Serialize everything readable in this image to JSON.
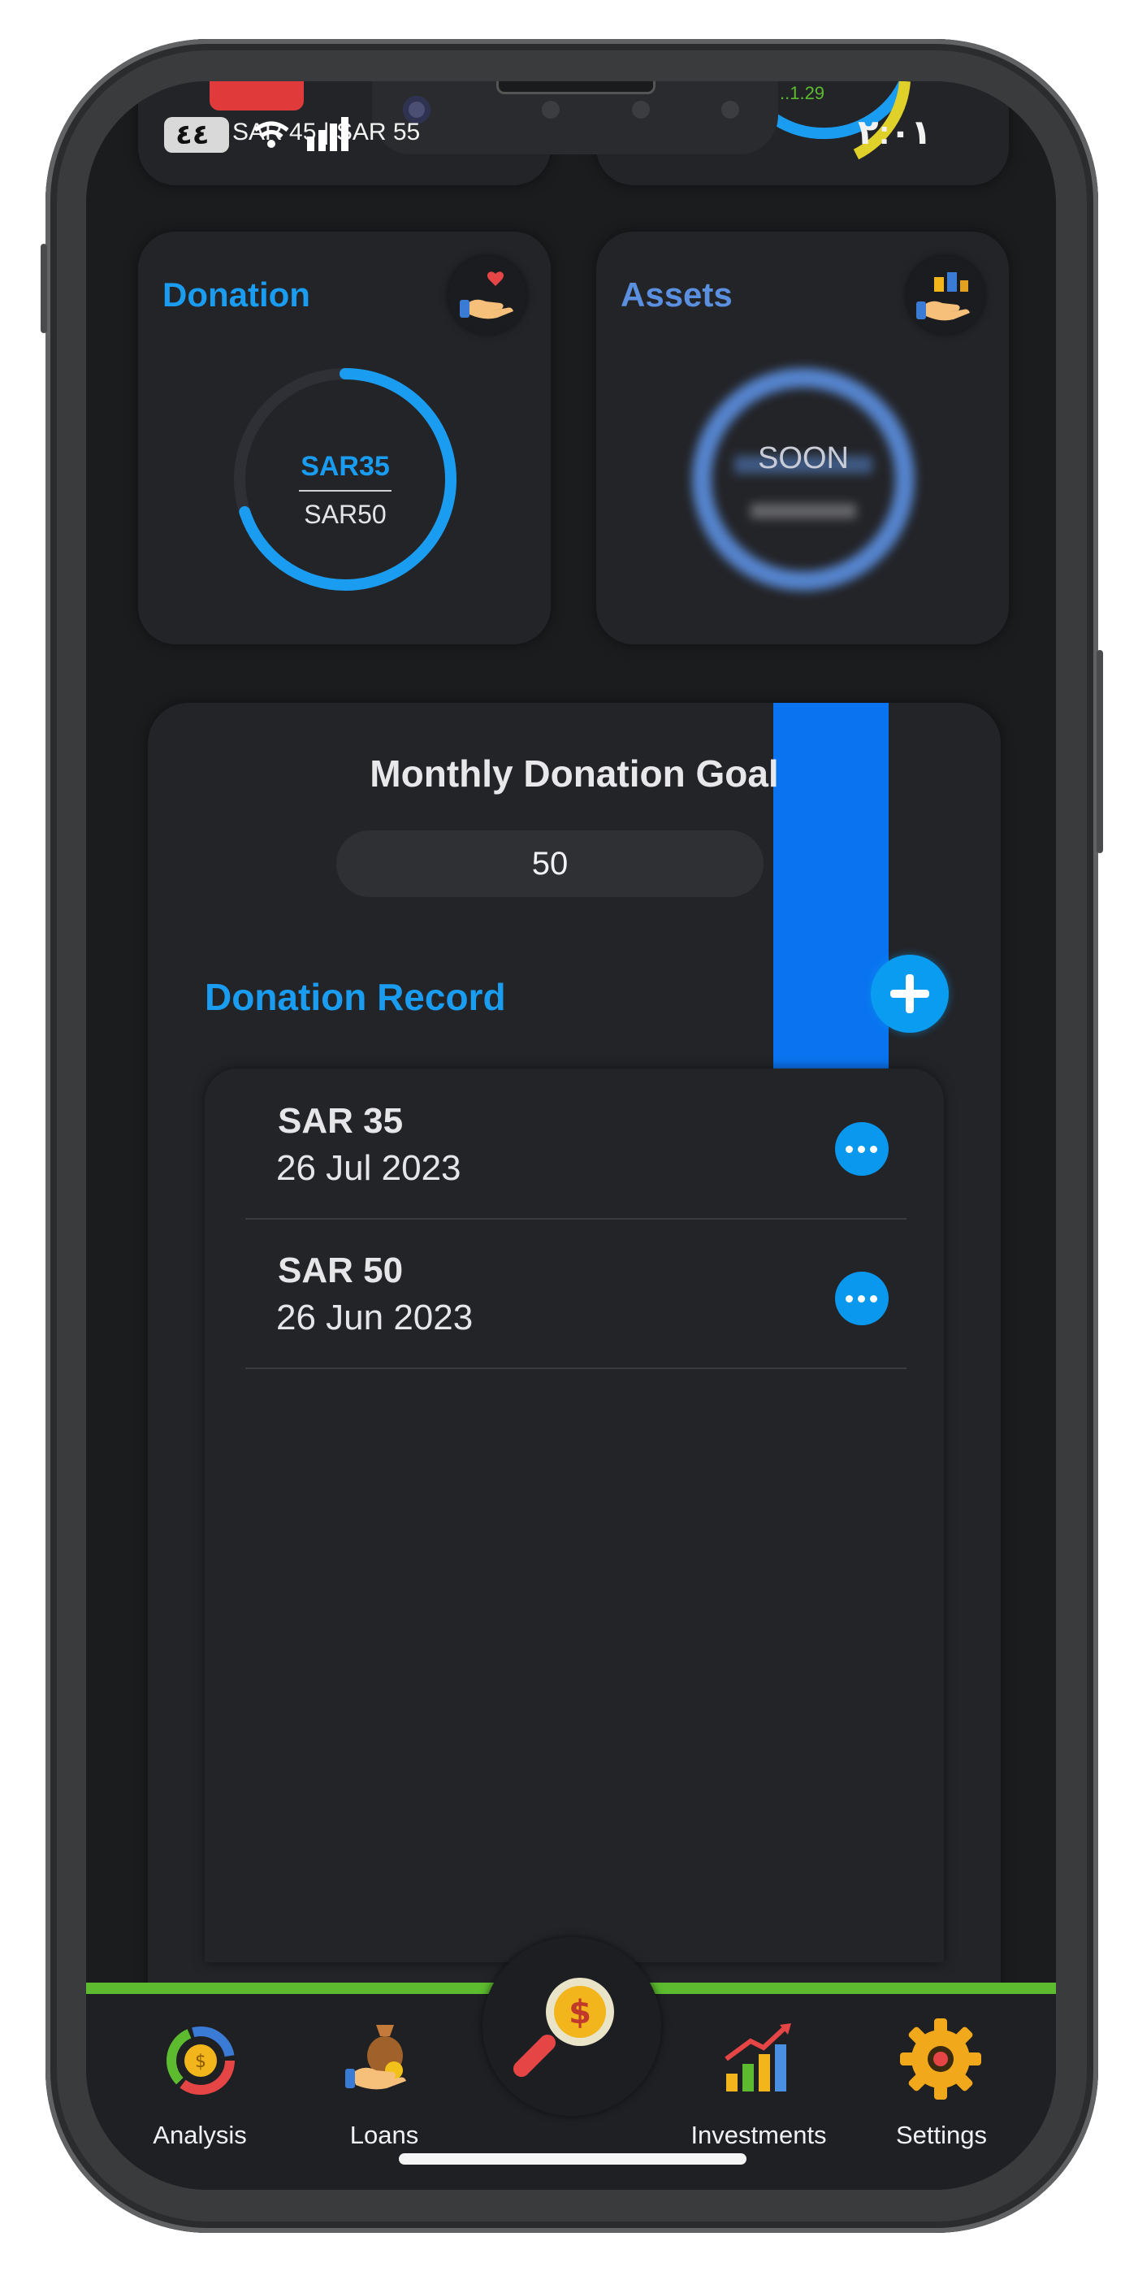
{
  "status_bar": {
    "left_text": "SAR 45 | SAR 55",
    "battery": "٤٤",
    "time": "٢:٠١"
  },
  "top_cards": {
    "left_indicator_color": "#e03a3a",
    "right_ring_label": "..1.29"
  },
  "donation_card": {
    "title": "Donation",
    "donated": "SAR35",
    "goal": "SAR50",
    "progress_fraction": 0.7,
    "icon": "heart-hand-icon",
    "accent": "#1a9cf0"
  },
  "assets_card": {
    "title": "Assets",
    "status": "SOON",
    "icon": "assets-hand-icon",
    "accent": "#5b8fe0"
  },
  "goal_panel": {
    "title": "Monthly Donation Goal",
    "goal_value": "50"
  },
  "record": {
    "title": "Donation Record",
    "add_icon": "plus-icon",
    "items": [
      {
        "amount": "SAR 35",
        "date": "26 Jul 2023"
      },
      {
        "amount": "SAR 50",
        "date": "26 Jun 2023"
      }
    ]
  },
  "tabbar": {
    "items": [
      {
        "label": "Analysis",
        "icon": "analysis-donut-icon"
      },
      {
        "label": "Loans",
        "icon": "loans-bag-icon"
      },
      {
        "label": "",
        "icon": "search-dollar-icon"
      },
      {
        "label": "Investments",
        "icon": "investments-chart-icon"
      },
      {
        "label": "Settings",
        "icon": "gear-icon"
      }
    ],
    "accent_line": "#5dbb2f"
  }
}
